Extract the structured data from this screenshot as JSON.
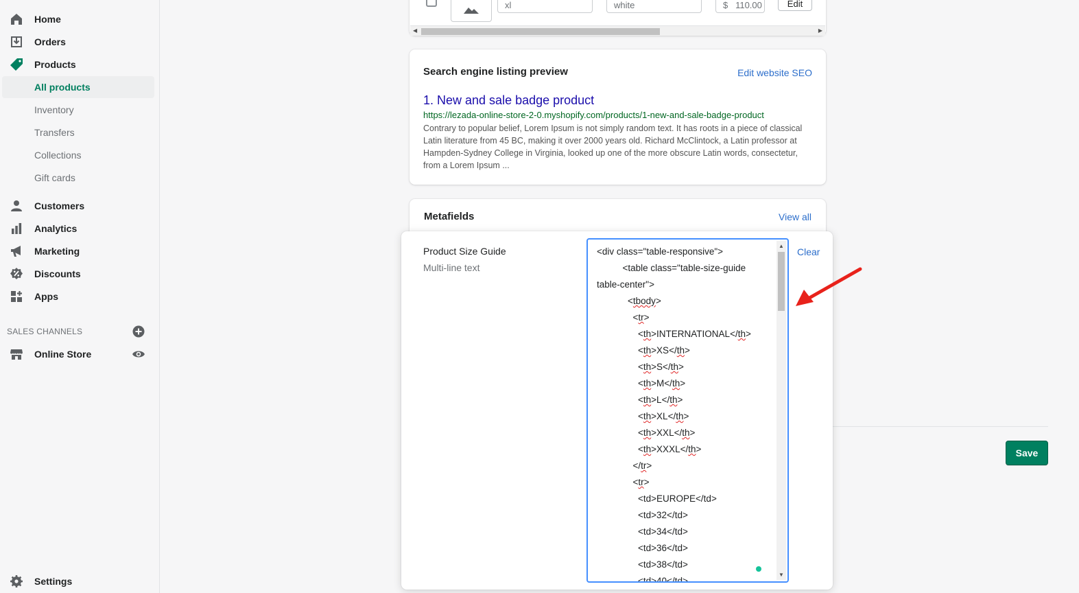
{
  "sidebar": {
    "items": [
      {
        "label": "Home",
        "icon": "home-icon"
      },
      {
        "label": "Orders",
        "icon": "orders-icon"
      },
      {
        "label": "Products",
        "icon": "tag-icon"
      }
    ],
    "product_sub": [
      {
        "label": "All products"
      },
      {
        "label": "Inventory"
      },
      {
        "label": "Transfers"
      },
      {
        "label": "Collections"
      },
      {
        "label": "Gift cards"
      }
    ],
    "items2": [
      {
        "label": "Customers",
        "icon": "person-icon"
      },
      {
        "label": "Analytics",
        "icon": "bar-chart-icon"
      },
      {
        "label": "Marketing",
        "icon": "megaphone-icon"
      },
      {
        "label": "Discounts",
        "icon": "discount-icon"
      },
      {
        "label": "Apps",
        "icon": "apps-icon"
      }
    ],
    "sales_channels_heading": "SALES CHANNELS",
    "online_store": "Online Store",
    "settings": "Settings"
  },
  "variant_row": {
    "size": "xl",
    "color": "white",
    "currency": "$",
    "price": "110.00",
    "edit": "Edit"
  },
  "seo": {
    "title": "Search engine listing preview",
    "edit_link": "Edit website SEO",
    "product_title": "1. New and sale badge product",
    "url": "https://lezada-online-store-2-0.myshopify.com/products/1-new-and-sale-badge-product",
    "description": "Contrary to popular belief, Lorem Ipsum is not simply random text. It has roots in a piece of classical Latin literature from 45 BC, making it over 2000 years old. Richard McClintock, a Latin professor at Hampden-Sydney College in Virginia, looked up one of the more obscure Latin words, consectetur, from a Lorem Ipsum ..."
  },
  "metafields": {
    "title": "Metafields",
    "view_all": "View all"
  },
  "editor": {
    "field_label": "Product Size Guide",
    "field_type": "Multi-line text",
    "clear": "Clear"
  },
  "save": "Save"
}
